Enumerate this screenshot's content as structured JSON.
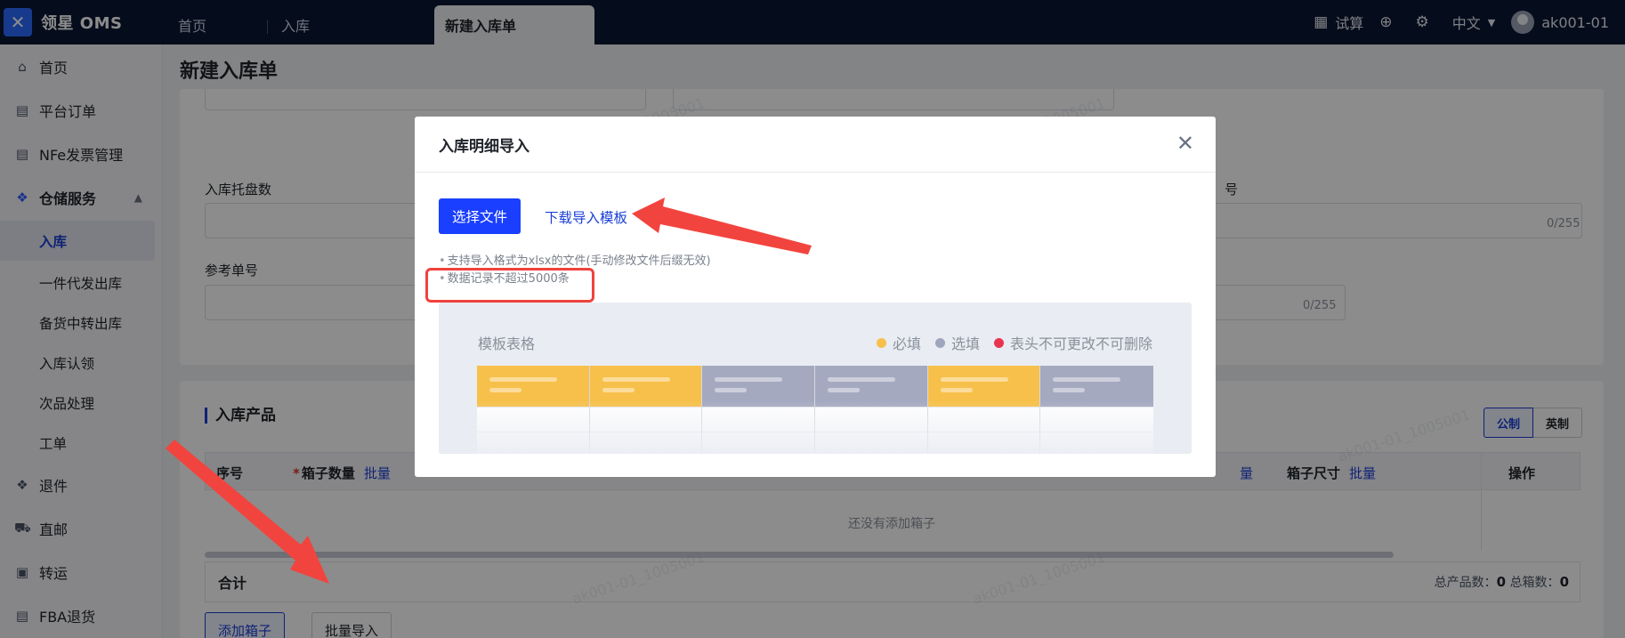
{
  "app": {
    "logo_text": "领星 OMS"
  },
  "tabs": [
    {
      "label": "首页"
    },
    {
      "label": "入库"
    },
    {
      "label": "新建入库单"
    }
  ],
  "topbar_right": {
    "calc_label": "试算",
    "language": "中文",
    "user": "ak001-01"
  },
  "sidebar": {
    "items": [
      {
        "label": "首页"
      },
      {
        "label": "平台订单"
      },
      {
        "label": "NFe发票管理"
      },
      {
        "label": "仓储服务"
      }
    ],
    "sub_items": [
      {
        "label": "入库"
      },
      {
        "label": "一件代发出库"
      },
      {
        "label": "备货中转出库"
      },
      {
        "label": "入库认领"
      },
      {
        "label": "次品处理"
      },
      {
        "label": "工单"
      }
    ],
    "bottom_items": [
      {
        "label": "退件"
      },
      {
        "label": "直邮"
      },
      {
        "label": "转运"
      },
      {
        "label": "FBA退货"
      }
    ]
  },
  "main": {
    "page_title": "新建入库单",
    "form": {
      "pallet_label": "入库托盘数",
      "ref_label": "参考单号",
      "counter": "0/255",
      "partial_label": "号"
    },
    "products": {
      "section_title": "入库产品",
      "unit_metric": "公制",
      "unit_imperial": "英制",
      "columns": {
        "seq": "序号",
        "box_qty": "箱子数量",
        "box_size": "箱子尺寸",
        "operation": "操作",
        "batch": "批量"
      },
      "empty_text": "还没有添加箱子",
      "total_label": "合计",
      "total_products_label": "总产品数：",
      "total_products": "0",
      "total_boxes_label": "总箱数：",
      "total_boxes": "0",
      "add_box_button": "添加箱子",
      "batch_import_button": "批量导入"
    }
  },
  "modal": {
    "title": "入库明细导入",
    "choose_file_button": "选择文件",
    "download_template_link": "下载导入模板",
    "hints": [
      "支持导入格式为xlsx的文件(手动修改文件后缀无效)",
      "数据记录不超过5000条"
    ],
    "preview": {
      "title": "模板表格",
      "legend": [
        {
          "label": "必填",
          "color": "#f7c04a"
        },
        {
          "label": "选填",
          "color": "#9fa5bd"
        },
        {
          "label": "表头不可更改不可删除",
          "color": "#e8344e"
        }
      ],
      "column_types": [
        "required",
        "required",
        "optional",
        "optional",
        "required",
        "optional"
      ]
    }
  },
  "watermark": "ak001-01_1005001",
  "colors": {
    "topbar": "#0a1633",
    "primary": "#1a3fff",
    "annotation_red": "#f0423d",
    "required": "#f7c04a",
    "optional": "#a4a9c0"
  }
}
